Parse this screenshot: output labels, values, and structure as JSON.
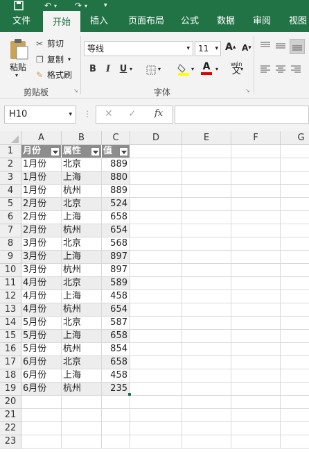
{
  "tabs": [
    "文件",
    "开始",
    "插入",
    "页面布局",
    "公式",
    "数据",
    "审阅",
    "视图"
  ],
  "clipboard": {
    "paste": "粘贴",
    "cut": "剪切",
    "copy": "复制",
    "format_painter": "格式刷",
    "group_label": "剪贴板"
  },
  "font": {
    "name": "等线",
    "size": "11",
    "bold": "B",
    "italic": "I",
    "underline": "U",
    "wen": "wén",
    "group_label": "字体"
  },
  "name_box": "H10",
  "fx": "fx",
  "columns": [
    "A",
    "B",
    "C",
    "D",
    "E",
    "F",
    "G"
  ],
  "rows": [
    "1",
    "2",
    "3",
    "4",
    "5",
    "6",
    "7",
    "8",
    "9",
    "10",
    "11",
    "12",
    "13",
    "14",
    "15",
    "16",
    "17",
    "18",
    "19",
    "20",
    "21",
    "22",
    "23"
  ],
  "table": {
    "headers": [
      "月份",
      "属性",
      "值"
    ],
    "rows": [
      [
        "1月份",
        "北京",
        "889"
      ],
      [
        "1月份",
        "上海",
        "880"
      ],
      [
        "1月份",
        "杭州",
        "889"
      ],
      [
        "2月份",
        "北京",
        "524"
      ],
      [
        "2月份",
        "上海",
        "658"
      ],
      [
        "2月份",
        "杭州",
        "654"
      ],
      [
        "3月份",
        "北京",
        "568"
      ],
      [
        "3月份",
        "上海",
        "897"
      ],
      [
        "3月份",
        "杭州",
        "897"
      ],
      [
        "4月份",
        "北京",
        "589"
      ],
      [
        "4月份",
        "上海",
        "458"
      ],
      [
        "4月份",
        "杭州",
        "654"
      ],
      [
        "5月份",
        "北京",
        "587"
      ],
      [
        "5月份",
        "上海",
        "658"
      ],
      [
        "5月份",
        "杭州",
        "854"
      ],
      [
        "6月份",
        "北京",
        "658"
      ],
      [
        "6月份",
        "上海",
        "458"
      ],
      [
        "6月份",
        "杭州",
        "235"
      ]
    ]
  },
  "colors": {
    "excel_green": "#217346",
    "table_header": "#8d8d8d",
    "band": "#ededed"
  }
}
